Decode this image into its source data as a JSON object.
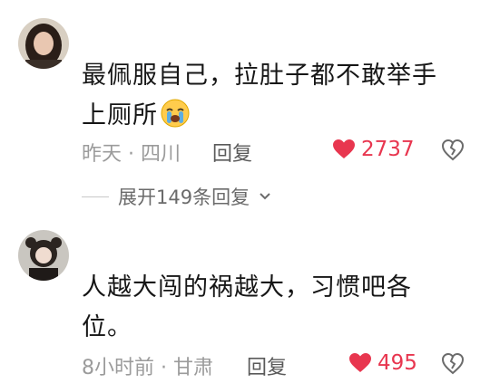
{
  "comments": [
    {
      "avatar": "user-avatar-woman",
      "text_line1": "最佩服自己，拉肚子都不敢举手",
      "text_line2": "上厕所",
      "emoji": "crying-face",
      "time_location": "昨天 · 四川",
      "reply_label": "回复",
      "likes": "2737",
      "expand_label": "展开149条回复"
    },
    {
      "avatar": "user-avatar-cartoon",
      "text_line1": "人越大闯的祸越大，习惯吧各",
      "text_line2": "位。",
      "time_location": "8小时前 · 甘肃",
      "reply_label": "回复",
      "likes": "495"
    }
  ],
  "colors": {
    "like": "#e8364f",
    "meta": "#9b9b9b"
  }
}
